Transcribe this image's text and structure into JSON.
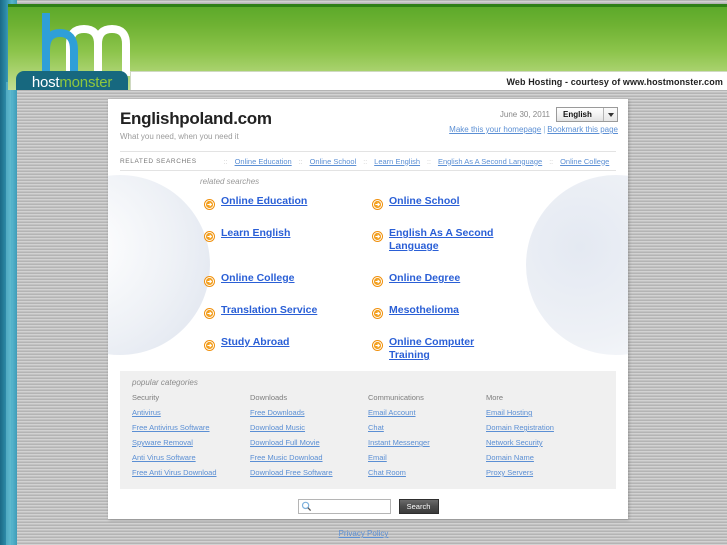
{
  "banner": {
    "logo_wordmark_host": "host",
    "logo_wordmark_monster": "monster",
    "courtesy_text": "Web Hosting - courtesy of www.hostmonster.com"
  },
  "header": {
    "site_title": "Englishpoland.com",
    "tagline": "What you need, when you need it",
    "date": "June 30, 2011",
    "language_selected": "English",
    "make_homepage_label": "Make this your homepage",
    "link_separator": "|",
    "bookmark_label": "Bookmark this page"
  },
  "related_bar": {
    "label": "RELATED SEARCHES",
    "separator": "::",
    "links": [
      "Online Education",
      "Online School",
      "Learn English",
      "English As A Second Language",
      "Online College"
    ]
  },
  "related_searches": {
    "heading": "related searches",
    "bullet_icon": "circle-arrow-right-icon",
    "items": [
      "Online Education",
      "Online School",
      "Learn English",
      "English As A Second Language",
      "Online College",
      "Online Degree",
      "Translation Service",
      "Mesothelioma",
      "Study Abroad",
      "Online Computer Training"
    ]
  },
  "popular_categories": {
    "heading": "popular categories",
    "columns": [
      {
        "title": "Security",
        "links": [
          "Antivirus",
          "Free Antivirus Software",
          "Spyware Removal",
          "Anti Virus Software",
          "Free Anti Virus Download"
        ]
      },
      {
        "title": "Downloads",
        "links": [
          "Free Downloads",
          "Download Music",
          "Download Full Movie",
          "Free Music Download",
          "Download Free Software"
        ]
      },
      {
        "title": "Communications",
        "links": [
          "Email Account",
          "Chat",
          "Instant Messenger",
          "Email",
          "Chat Room"
        ]
      },
      {
        "title": "More",
        "links": [
          "Email Hosting",
          "Domain Registration",
          "Network Security",
          "Domain Name",
          "Proxy Servers"
        ]
      }
    ]
  },
  "search": {
    "icon": "magnifier-icon",
    "value": "",
    "placeholder": "",
    "button_label": "Search"
  },
  "footer": {
    "privacy_label": "Privacy Policy"
  },
  "colors": {
    "banner_green": "#8cc44b",
    "logo_teal": "#17687f",
    "link_blue": "#5b8fd4",
    "rs_link_blue": "#2a5fd6",
    "bullet_orange": "#f08000",
    "rail_teal": "#2d8ba8"
  }
}
